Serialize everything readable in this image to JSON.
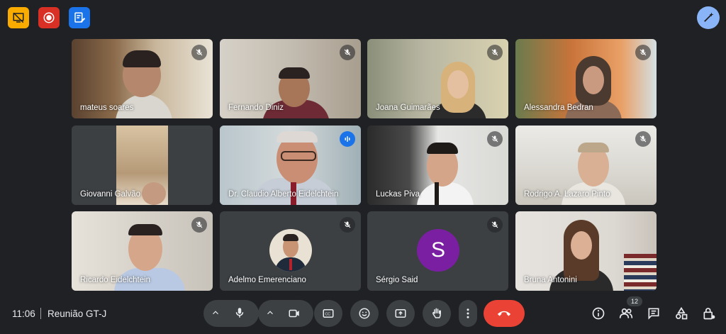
{
  "participants": [
    {
      "name": "mateus soares",
      "muted": true
    },
    {
      "name": "Fernando Diniz",
      "muted": true
    },
    {
      "name": "Joana Guimarães",
      "muted": true
    },
    {
      "name": "Alessandra Bedran",
      "muted": true
    },
    {
      "name": "Giovanni Galvão",
      "muted": false
    },
    {
      "name": "Dr. Claudio Alberto Eidelchtein",
      "muted": false,
      "speaking": true
    },
    {
      "name": "Luckas Piva",
      "muted": true
    },
    {
      "name": "Rodrigo A. Lazaro Pinto",
      "muted": true
    },
    {
      "name": "Ricardo Eidelchtein",
      "muted": true
    },
    {
      "name": "Adelmo Emerenciano",
      "muted": true
    },
    {
      "name": "Sérgio Said",
      "muted": true,
      "initial": "S"
    },
    {
      "name": "Bruna Antonini",
      "muted": false
    }
  ],
  "bottom": {
    "time": "11:06",
    "meeting_name": "Reunião GT-J",
    "people_count": "12"
  },
  "colors": {
    "background": "#202124",
    "tile": "#3c4043",
    "end_call": "#ea4335",
    "accent": "#8ab4f8",
    "speaking": "#1a73e8",
    "avatar_s": "#7b1fa2"
  }
}
